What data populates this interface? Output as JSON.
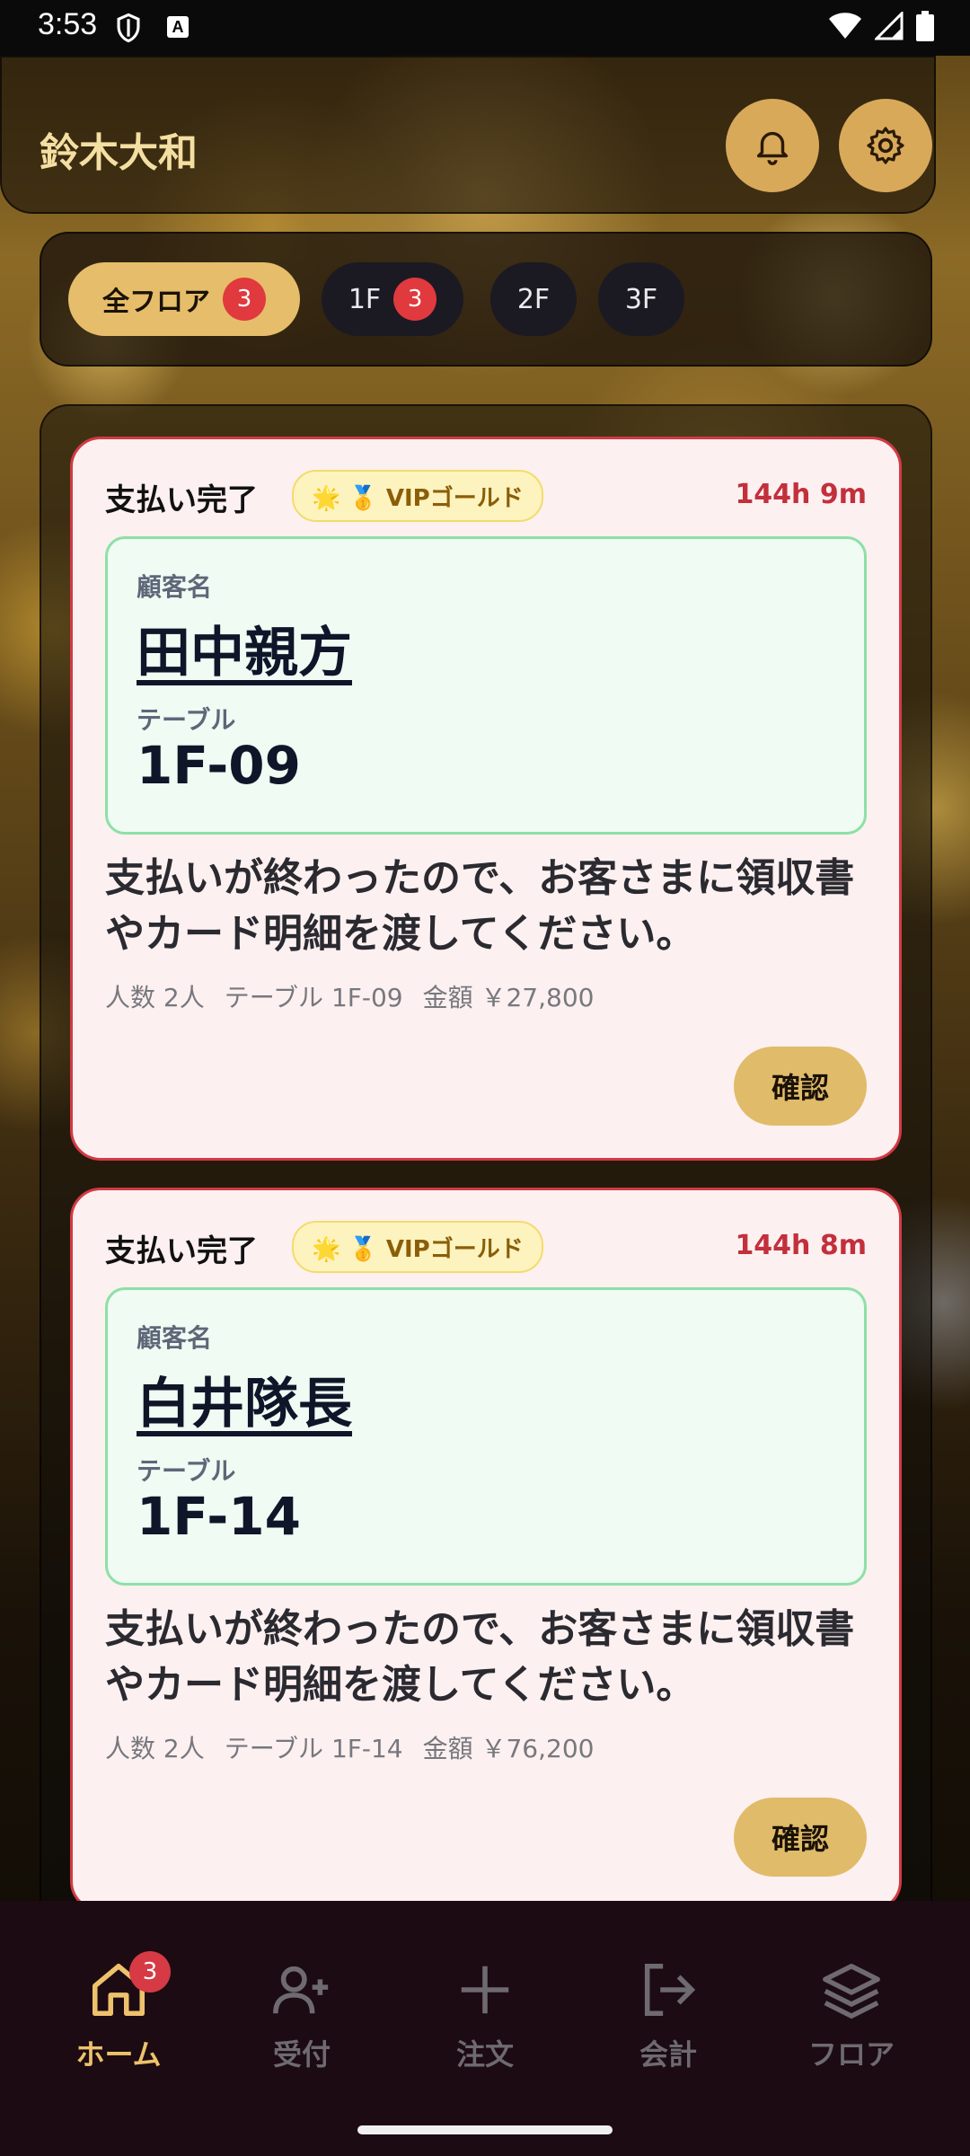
{
  "status_bar": {
    "time": "3:53",
    "a_label": "A"
  },
  "header": {
    "title": "鈴木大和",
    "bell_icon": "bell-icon",
    "settings_icon": "gear-icon"
  },
  "floors": [
    {
      "label": "全フロア",
      "badge": "3"
    },
    {
      "label": "1F",
      "badge": "3"
    },
    {
      "label": "2F"
    },
    {
      "label": "3F"
    }
  ],
  "cards": [
    {
      "status": "支払い完了",
      "vip": "🌟 🥇 VIPゴールド",
      "elapsed": "144h 9m",
      "customer_label": "顧客名",
      "customer_name": "田中親方",
      "table_label": "テーブル",
      "table": "1F-09",
      "message": "支払いが終わったので、お客さまに領収書やカード明細を渡してください。",
      "meta_people": "人数 2人",
      "meta_table": "テーブル 1F-09",
      "meta_amount": "金額 ￥27,800",
      "confirm": "確認"
    },
    {
      "status": "支払い完了",
      "vip": "🌟 🥇 VIPゴールド",
      "elapsed": "144h 8m",
      "customer_label": "顧客名",
      "customer_name": "白井隊長",
      "table_label": "テーブル",
      "table": "1F-14",
      "message": "支払いが終わったので、お客さまに領収書やカード明細を渡してください。",
      "meta_people": "人数 2人",
      "meta_table": "テーブル 1F-14",
      "meta_amount": "金額 ￥76,200",
      "confirm": "確認"
    }
  ],
  "nav": [
    {
      "label": "ホーム",
      "icon": "home-icon",
      "badge": "3"
    },
    {
      "label": "受付",
      "icon": "user-plus-icon"
    },
    {
      "label": "注文",
      "icon": "plus-icon"
    },
    {
      "label": "会計",
      "icon": "logout-icon"
    },
    {
      "label": "フロア",
      "icon": "layers-icon"
    }
  ],
  "colors": {
    "accent": "#e6bd6a",
    "alert": "#d33a44",
    "card_bg": "#fdf0f0",
    "info_bg": "#effbf3"
  }
}
